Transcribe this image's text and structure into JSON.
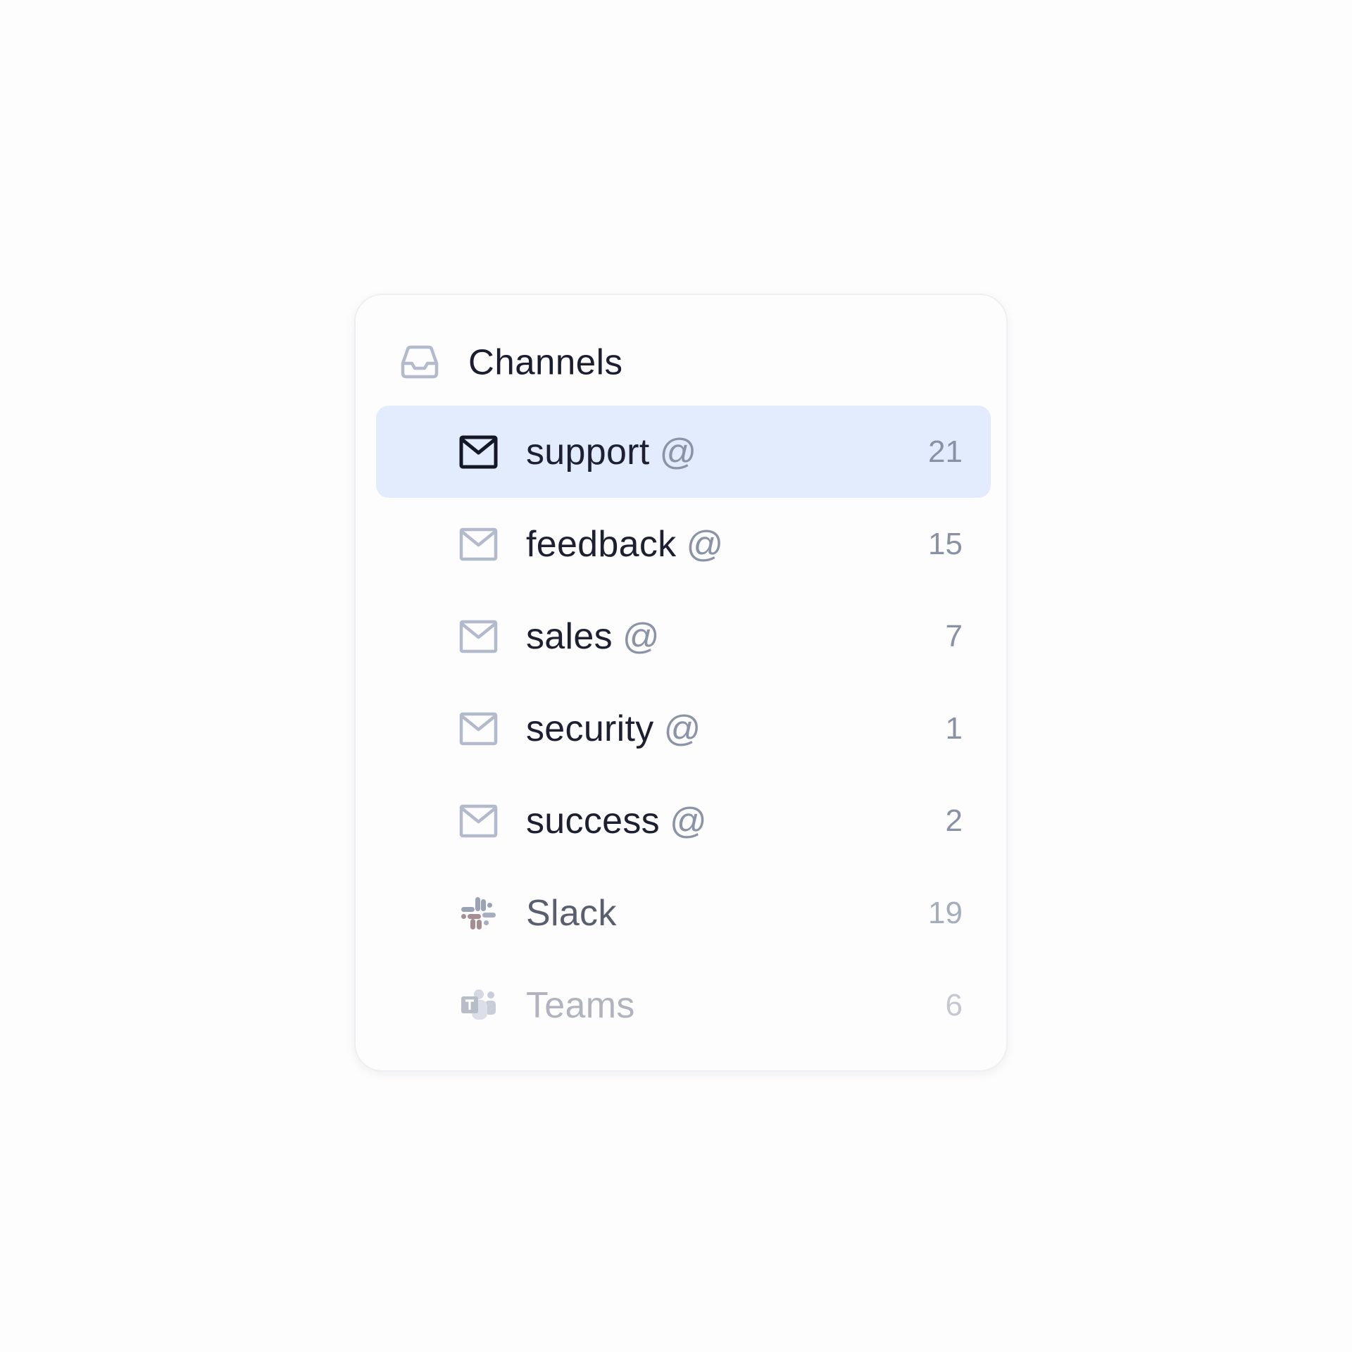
{
  "header": {
    "title": "Channels",
    "icon": "inbox-icon"
  },
  "channels": [
    {
      "name": "support",
      "suffix": "@",
      "count": "21",
      "icon": "mail-icon",
      "active": true
    },
    {
      "name": "feedback",
      "suffix": "@",
      "count": "15",
      "icon": "mail-icon",
      "active": false
    },
    {
      "name": "sales",
      "suffix": "@",
      "count": "7",
      "icon": "mail-icon",
      "active": false
    },
    {
      "name": "security",
      "suffix": "@",
      "count": "1",
      "icon": "mail-icon",
      "active": false
    },
    {
      "name": "success",
      "suffix": "@",
      "count": "2",
      "icon": "mail-icon",
      "active": false
    },
    {
      "name": "Slack",
      "count": "19",
      "icon": "slack-icon",
      "active": false
    },
    {
      "name": "Teams",
      "count": "6",
      "icon": "teams-icon",
      "active": false
    }
  ],
  "colors": {
    "active_background": "#e3ecfd",
    "text_primary": "#1c2030",
    "text_muted": "#8991a5",
    "icon_muted": "#b3bacb"
  }
}
